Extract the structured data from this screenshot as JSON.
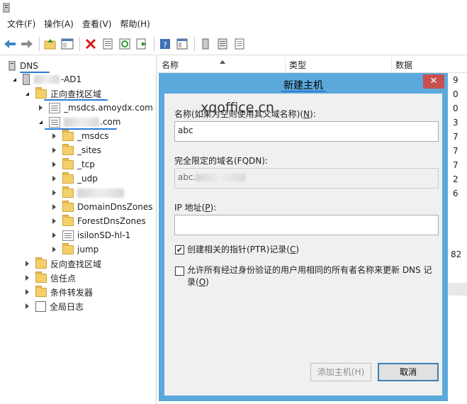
{
  "menu": [
    "文件(F)",
    "操作(A)",
    "查看(V)",
    "帮助(H)"
  ],
  "toolbar_icons": [
    "back-arrow-icon",
    "forward-arrow-icon",
    "up-folder-icon",
    "show-tree-icon",
    "delete-icon",
    "properties-icon",
    "refresh-icon",
    "export-icon",
    "help-icon",
    "console-icon",
    "server-icon",
    "list-icon",
    "records-icon"
  ],
  "tree": {
    "root": "DNS",
    "server": "-AD1",
    "forward": "正向查找区域",
    "msdcs_zone": "_msdcs.amoydx.com",
    "zone_suffix": ".com",
    "zone_children": [
      "_msdcs",
      "_sites",
      "_tcp",
      "_udp",
      "",
      "DomainDnsZones",
      "ForestDnsZones",
      "isilonSD-hl-1",
      "jump"
    ],
    "reverse": "反向查找区域",
    "trust": "信任点",
    "forwarders": "条件转发器",
    "global_log": "全局日志"
  },
  "list": {
    "headers": [
      "名称",
      "类型",
      "数据"
    ],
    "edge_digits": [
      "9",
      "0",
      "0",
      "3",
      "7",
      "7",
      "7",
      "2",
      "6",
      "82"
    ]
  },
  "dialog": {
    "title": "新建主机",
    "close": "✕",
    "name_label": "名称(如果为空则使用其父域名称)(",
    "name_key": "N",
    "name_label_end": "):",
    "name_value": "abc",
    "fqdn_label": "完全限定的域名(FQDN):",
    "fqdn_value": "abc.",
    "ip_label": "IP 地址(",
    "ip_key": "P",
    "ip_label_end": "):",
    "ip_value": "",
    "ptr_label": "创建相关的指针(PTR)记录(",
    "ptr_key": "C",
    "ptr_label_end": ")",
    "ptr_checked": true,
    "allow_label_1": "允许所有经过身份验证的用户用相同的所有者名称来更新 DNS 记",
    "allow_label_2": "录(",
    "allow_key": "O",
    "allow_label_end": ")",
    "allow_checked": false,
    "add_button": "添加主机(H)",
    "cancel_button": "取消"
  },
  "watermark": "xqoffice.cn",
  "colors": {
    "dialog_frame": "#5ba9dc",
    "close": "#c75050",
    "folder": "#f4cf6a",
    "underline": "#2b7bd4"
  }
}
